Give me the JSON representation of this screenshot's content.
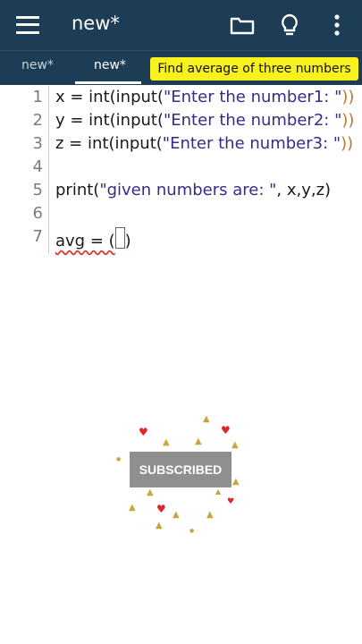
{
  "appbar": {
    "title": "new*"
  },
  "tabs": [
    {
      "label": "new*",
      "active": false
    },
    {
      "label": "new*",
      "active": true
    }
  ],
  "banner": {
    "text": "Find average of three numbers"
  },
  "editor": {
    "lines": [
      {
        "num": "1",
        "pre": "x = int(input(",
        "str": "\"Enter the number1: \"",
        "post": "))"
      },
      {
        "num": "2",
        "pre": "y = int(input(",
        "str": "\"Enter the number2: \"",
        "post": "))"
      },
      {
        "num": "3",
        "pre": "z = int(input(",
        "str": "\"Enter the number3: \"",
        "post": "))"
      },
      {
        "num": "4",
        "pre": "",
        "str": "",
        "post": ""
      },
      {
        "num": "5",
        "pre": "print(",
        "str": "\"given numbers are: \"",
        "post": ", x,y,z)"
      },
      {
        "num": "6",
        "pre": "",
        "str": "",
        "post": ""
      },
      {
        "num": "7",
        "pre": "avg = (",
        "str": "",
        "post": ")"
      }
    ]
  },
  "overlay": {
    "subscribe_label": "SUBSCRIBED"
  },
  "colors": {
    "appbar": "#1c3d55",
    "banner": "#f7f21d",
    "string": "#3a2a86"
  }
}
